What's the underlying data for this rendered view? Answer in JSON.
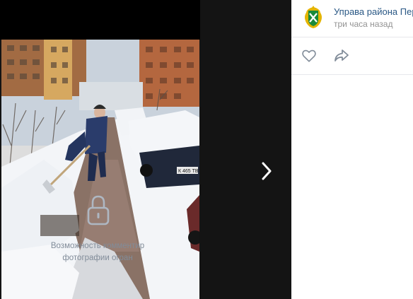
{
  "post": {
    "author": "Управа района Перо",
    "time": "три часа назад"
  },
  "actions": {
    "like_icon": "heart-outline-icon",
    "share_icon": "share-arrow-icon"
  },
  "comments": {
    "closed_line1": "Возможность комментир",
    "closed_line2": "фотографии огран"
  },
  "photo": {
    "plate_text": "К 465 ТВ"
  },
  "navigation": {
    "next_icon": "chevron-right-icon"
  },
  "colors": {
    "viewer_background": "#141414",
    "author_link": "#2a5885",
    "secondary_text": "#939393",
    "icon_gray": "#818c99",
    "lock_gray": "#aeb7c2"
  }
}
